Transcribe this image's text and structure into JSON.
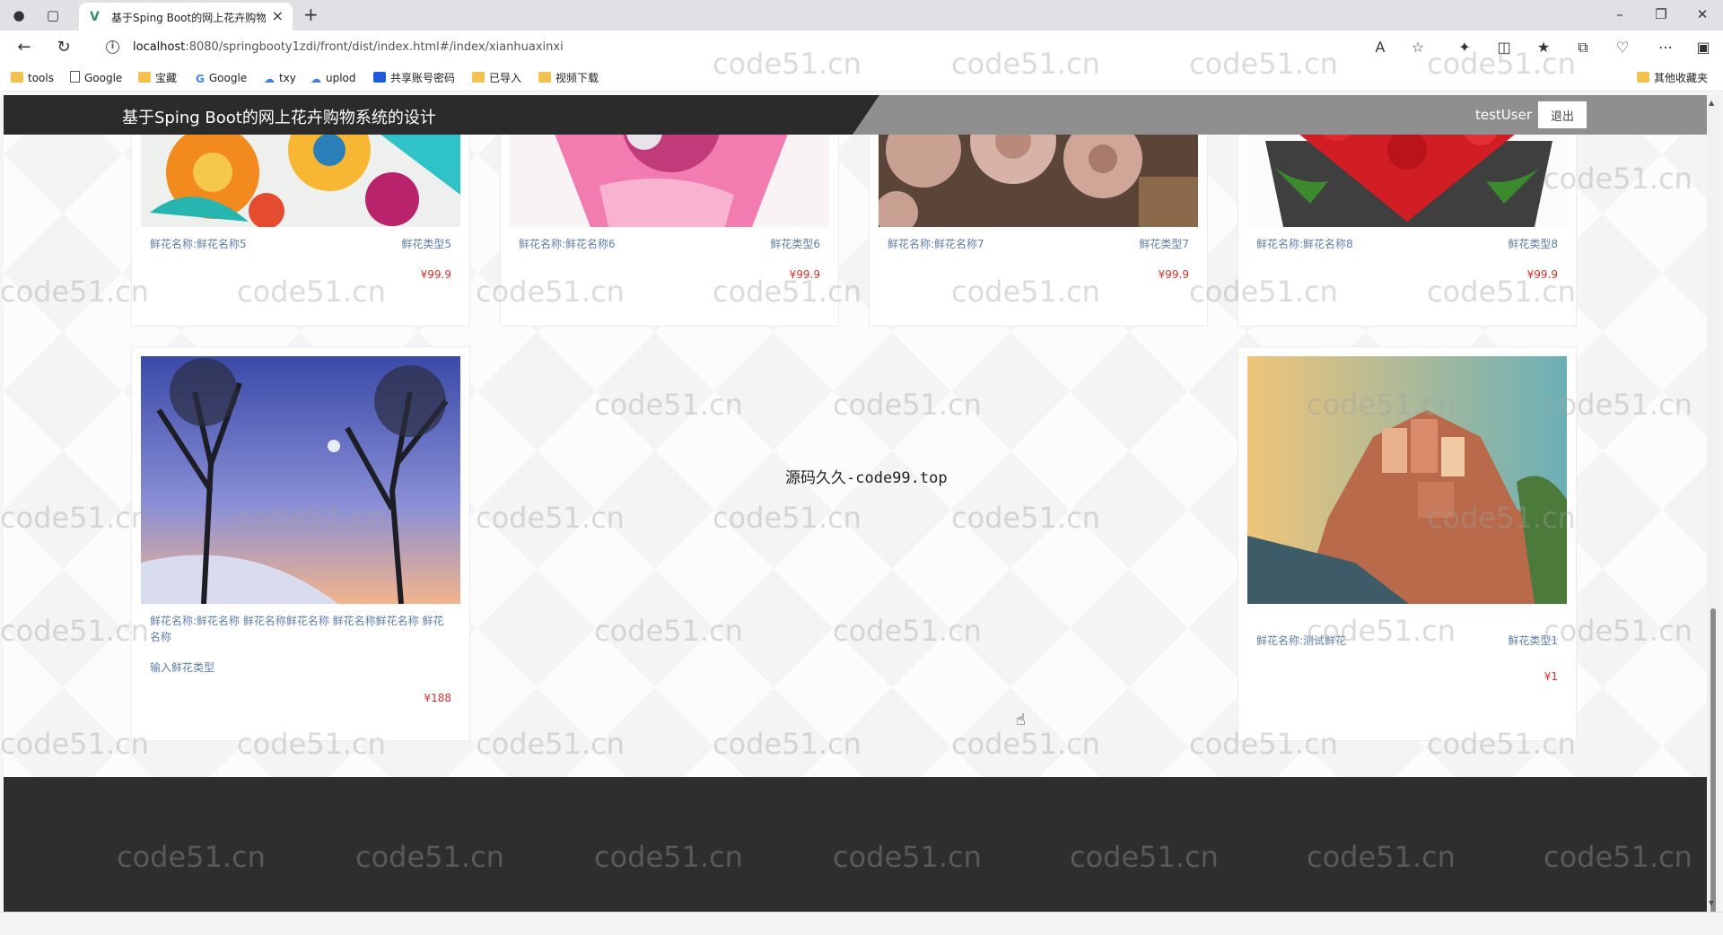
{
  "browser": {
    "tab_title": "基于Sping Boot的网上花卉购物",
    "url_host": "localhost",
    "url_rest": ":8080/springbooty1zdi/front/dist/index.html#/index/xianhuaxinxi",
    "bookmarks": [
      "tools",
      "Google",
      "宝藏",
      "Google",
      "txy",
      "uplod",
      "共享账号密码",
      "已导入",
      "视频下载"
    ],
    "other_bookmarks": "其他收藏夹"
  },
  "site": {
    "title": "基于Sping Boot的网上花卉购物系统的设计",
    "user": "testUser",
    "logout_label": "退出"
  },
  "row1": [
    {
      "name": "鲜花名称:鲜花名称5",
      "type": "鲜花类型5",
      "price": "¥99.9"
    },
    {
      "name": "鲜花名称:鲜花名称6",
      "type": "鲜花类型6",
      "price": "¥99.9"
    },
    {
      "name": "鲜花名称:鲜花名称7",
      "type": "鲜花类型7",
      "price": "¥99.9"
    },
    {
      "name": "鲜花名称:鲜花名称8",
      "type": "鲜花类型8",
      "price": "¥99.9"
    }
  ],
  "row2": [
    {
      "name": "鲜花名称:鲜花名称 鲜花名称鲜花名称 鲜花名称鲜花名称 鲜花名称",
      "type": "输入鲜花类型",
      "price": "¥188"
    },
    {
      "name": "鲜花名称:测试鲜花",
      "type": "鲜花类型1",
      "price": "¥1"
    }
  ],
  "center_note": "源码久久-code99.top",
  "watermark": "code51.cn",
  "colors": {
    "header": "#2b2b2b",
    "accent_gray": "#8f8f8f",
    "price": "#d0312d",
    "meta": "#5f7fa8",
    "footer": "#2e2e2e"
  }
}
